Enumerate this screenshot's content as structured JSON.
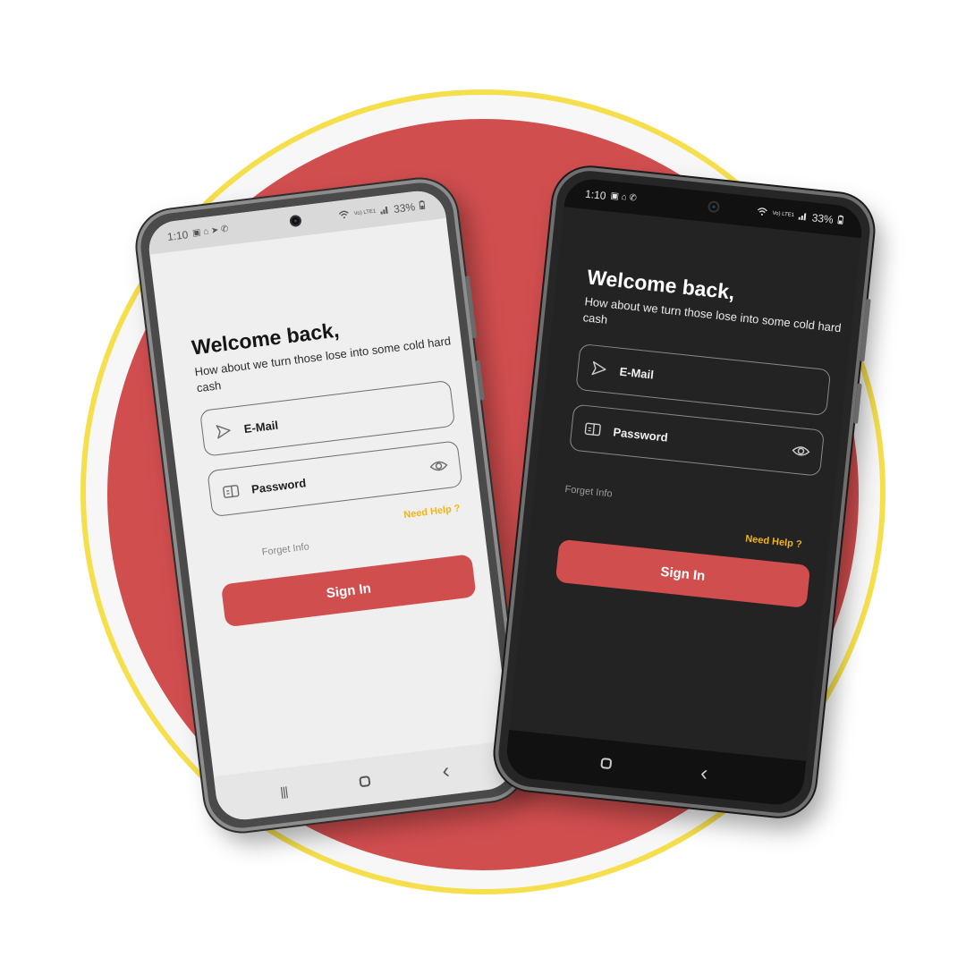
{
  "phones": {
    "light": {
      "status": {
        "time": "1:10",
        "battery": "33%",
        "network": "Vo) LTE1"
      },
      "title": "Welcome back,",
      "subtitle": "How about we turn those lose into some cold hard cash",
      "email_label": "E-Mail",
      "password_label": "Password",
      "need_help": "Need Help ?",
      "forget_info": "Forget Info",
      "signin_label": "Sign In",
      "nav": {
        "recents": "|||",
        "back": "‹"
      }
    },
    "dark": {
      "status": {
        "time": "1:10",
        "battery": "33%",
        "network": "Vo) LTE1"
      },
      "title": "Welcome back,",
      "subtitle": "How about we turn those lose into some cold hard cash",
      "email_label": "E-Mail",
      "password_label": "Password",
      "need_help": "Need Help ?",
      "forget_info": "Forget Info",
      "signin_label": "Sign In",
      "nav": {
        "back": "‹"
      }
    }
  },
  "colors": {
    "accent_red": "#d14e4f",
    "ring_yellow": "#f5df4d",
    "help_link": "#f1b51c",
    "light_screen_bg": "#efefef",
    "dark_screen_bg": "#232323"
  },
  "icons": [
    "send-icon",
    "id-card-icon",
    "eye-icon",
    "wifi-icon",
    "signal-icon",
    "battery-icon",
    "home-icon",
    "back-icon",
    "recents-icon"
  ]
}
